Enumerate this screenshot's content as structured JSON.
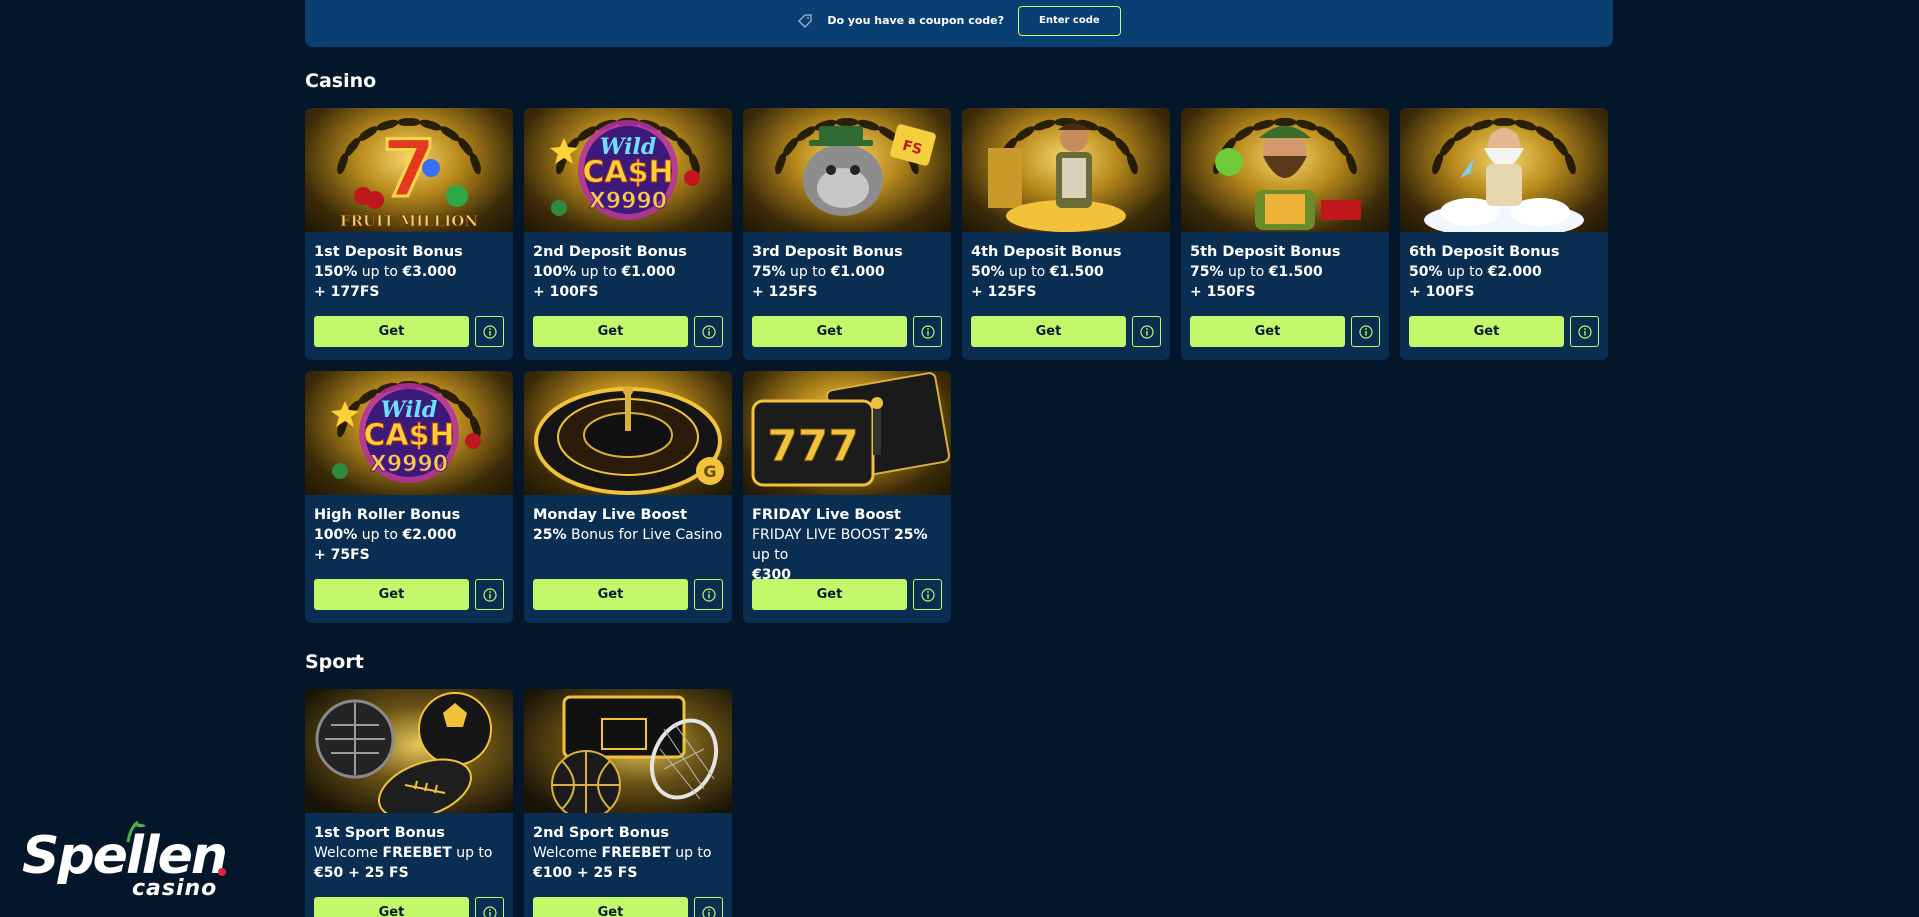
{
  "coupon": {
    "prompt": "Do you have a coupon code?",
    "button_label": "Enter code",
    "icon": "tag-icon"
  },
  "sections": {
    "casino": {
      "title": "Casino"
    },
    "sport": {
      "title": "Sport"
    }
  },
  "buttons": {
    "get": "Get"
  },
  "casino_cards": [
    {
      "title": "1st Deposit Bonus",
      "pct": "150%",
      "mid": " up to ",
      "amount": "€3.000",
      "extra": "+ 177FS",
      "art": "seven-fruit-million"
    },
    {
      "title": "2nd Deposit Bonus",
      "pct": "100%",
      "mid": " up to ",
      "amount": "€1.000",
      "extra": "+ 100FS",
      "art": "wild-cash-x9990"
    },
    {
      "title": "3rd Deposit Bonus",
      "pct": "75%",
      "mid": " up to ",
      "amount": "€1.000",
      "extra": "+ 125FS",
      "art": "bulldog-fs"
    },
    {
      "title": "4th Deposit Bonus",
      "pct": "50%",
      "mid": " up to ",
      "amount": "€1.500",
      "extra": "+ 125FS",
      "art": "explorer-gold"
    },
    {
      "title": "5th Deposit Bonus",
      "pct": "75%",
      "mid": " up to ",
      "amount": "€1.500",
      "extra": "+ 150FS",
      "art": "bearded-farmer"
    },
    {
      "title": "6th Deposit Bonus",
      "pct": "50%",
      "mid": " up to ",
      "amount": "€2.000",
      "extra": "+ 100FS",
      "art": "zeus-cloud"
    },
    {
      "title": "High Roller Bonus",
      "pct": "100%",
      "mid": " up to ",
      "amount": "€2.000",
      "extra": "+ 75FS",
      "art": "wild-cash-x9990"
    },
    {
      "title": "Monday Live Boost",
      "pct": "25%",
      "mid": " Bonus for Live Casino",
      "amount": "",
      "extra": "",
      "art": "roulette-wheel"
    },
    {
      "title": "FRIDAY Live Boost",
      "pre": "FRIDAY LIVE BOOST ",
      "pct": "25%",
      "mid": " up to",
      "amount": "€300",
      "extra": "",
      "art": "slot-777"
    }
  ],
  "sport_cards": [
    {
      "title": "1st Sport Bonus",
      "pre": "Welcome ",
      "bold": "FREEBET",
      "mid": " up to",
      "amount": "€50 + 25 FS",
      "art": "sport-balls"
    },
    {
      "title": "2nd Sport Bonus",
      "pre": "Welcome ",
      "bold": "FREEBET",
      "mid": " up to",
      "amount": "€100 + 25 FS",
      "art": "basketball-tennis"
    }
  ],
  "logo": {
    "main": "Spellen",
    "sub": "casino"
  },
  "colors": {
    "background": "#04162a",
    "card": "#0a2d52",
    "coupon_bar": "#0a3f74",
    "accent": "#c2f86a"
  }
}
